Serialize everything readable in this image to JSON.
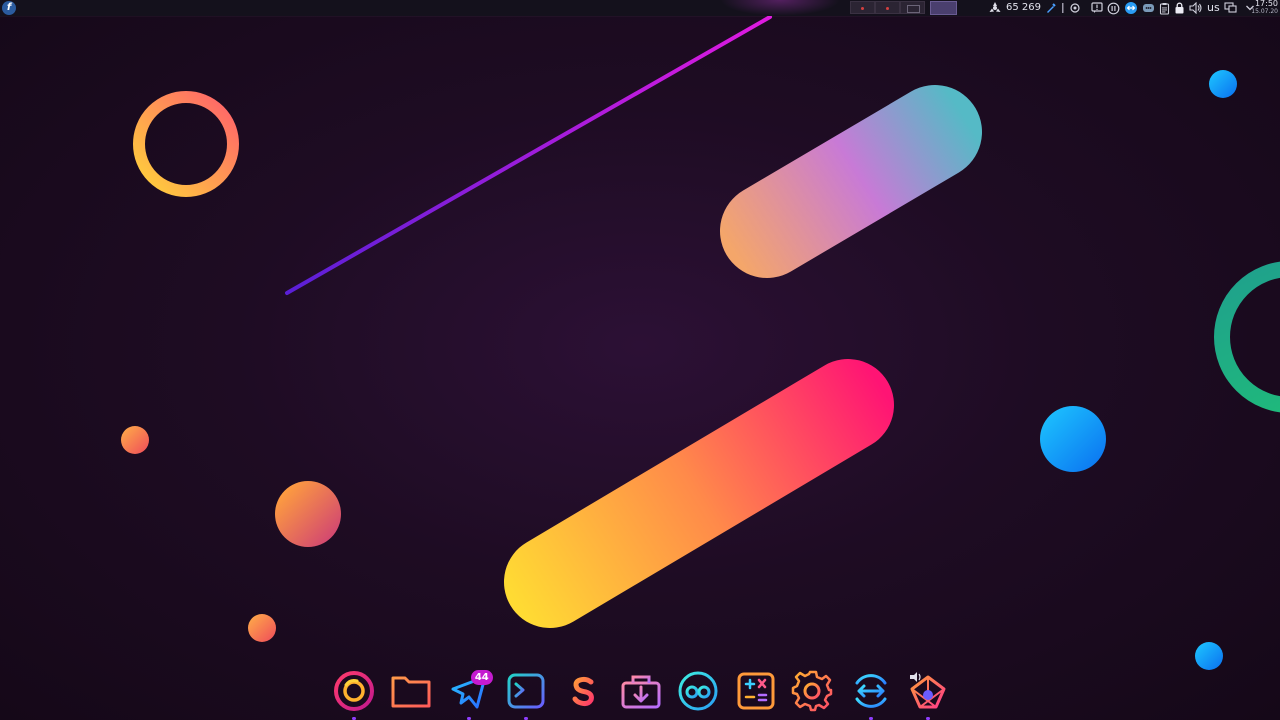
{
  "panel": {
    "launcher_glyph": "f",
    "activities": {
      "count": "65 269"
    },
    "keyboard_layout": "us",
    "clock": {
      "time": "17:50",
      "date": "15.07.20"
    }
  },
  "dock": {
    "items": [
      {
        "name": "firefox-icon",
        "indicator": true
      },
      {
        "name": "files-icon",
        "indicator": false
      },
      {
        "name": "messenger-icon",
        "indicator": true,
        "badge": "44"
      },
      {
        "name": "terminal-icon",
        "indicator": true
      },
      {
        "name": "s-app-icon",
        "indicator": false
      },
      {
        "name": "software-center-icon",
        "indicator": false
      },
      {
        "name": "qbittorrent-icon",
        "indicator": false
      },
      {
        "name": "calculator-icon",
        "indicator": false
      },
      {
        "name": "settings-icon",
        "indicator": false
      },
      {
        "name": "remote-desktop-icon",
        "indicator": true
      },
      {
        "name": "audio-app-icon",
        "indicator": true
      }
    ]
  },
  "colors": {
    "panel_bg": "#14111c",
    "desktop_bg": "#1e0c23",
    "accent": "#8f3dfd",
    "badge": "#c51bd0"
  }
}
